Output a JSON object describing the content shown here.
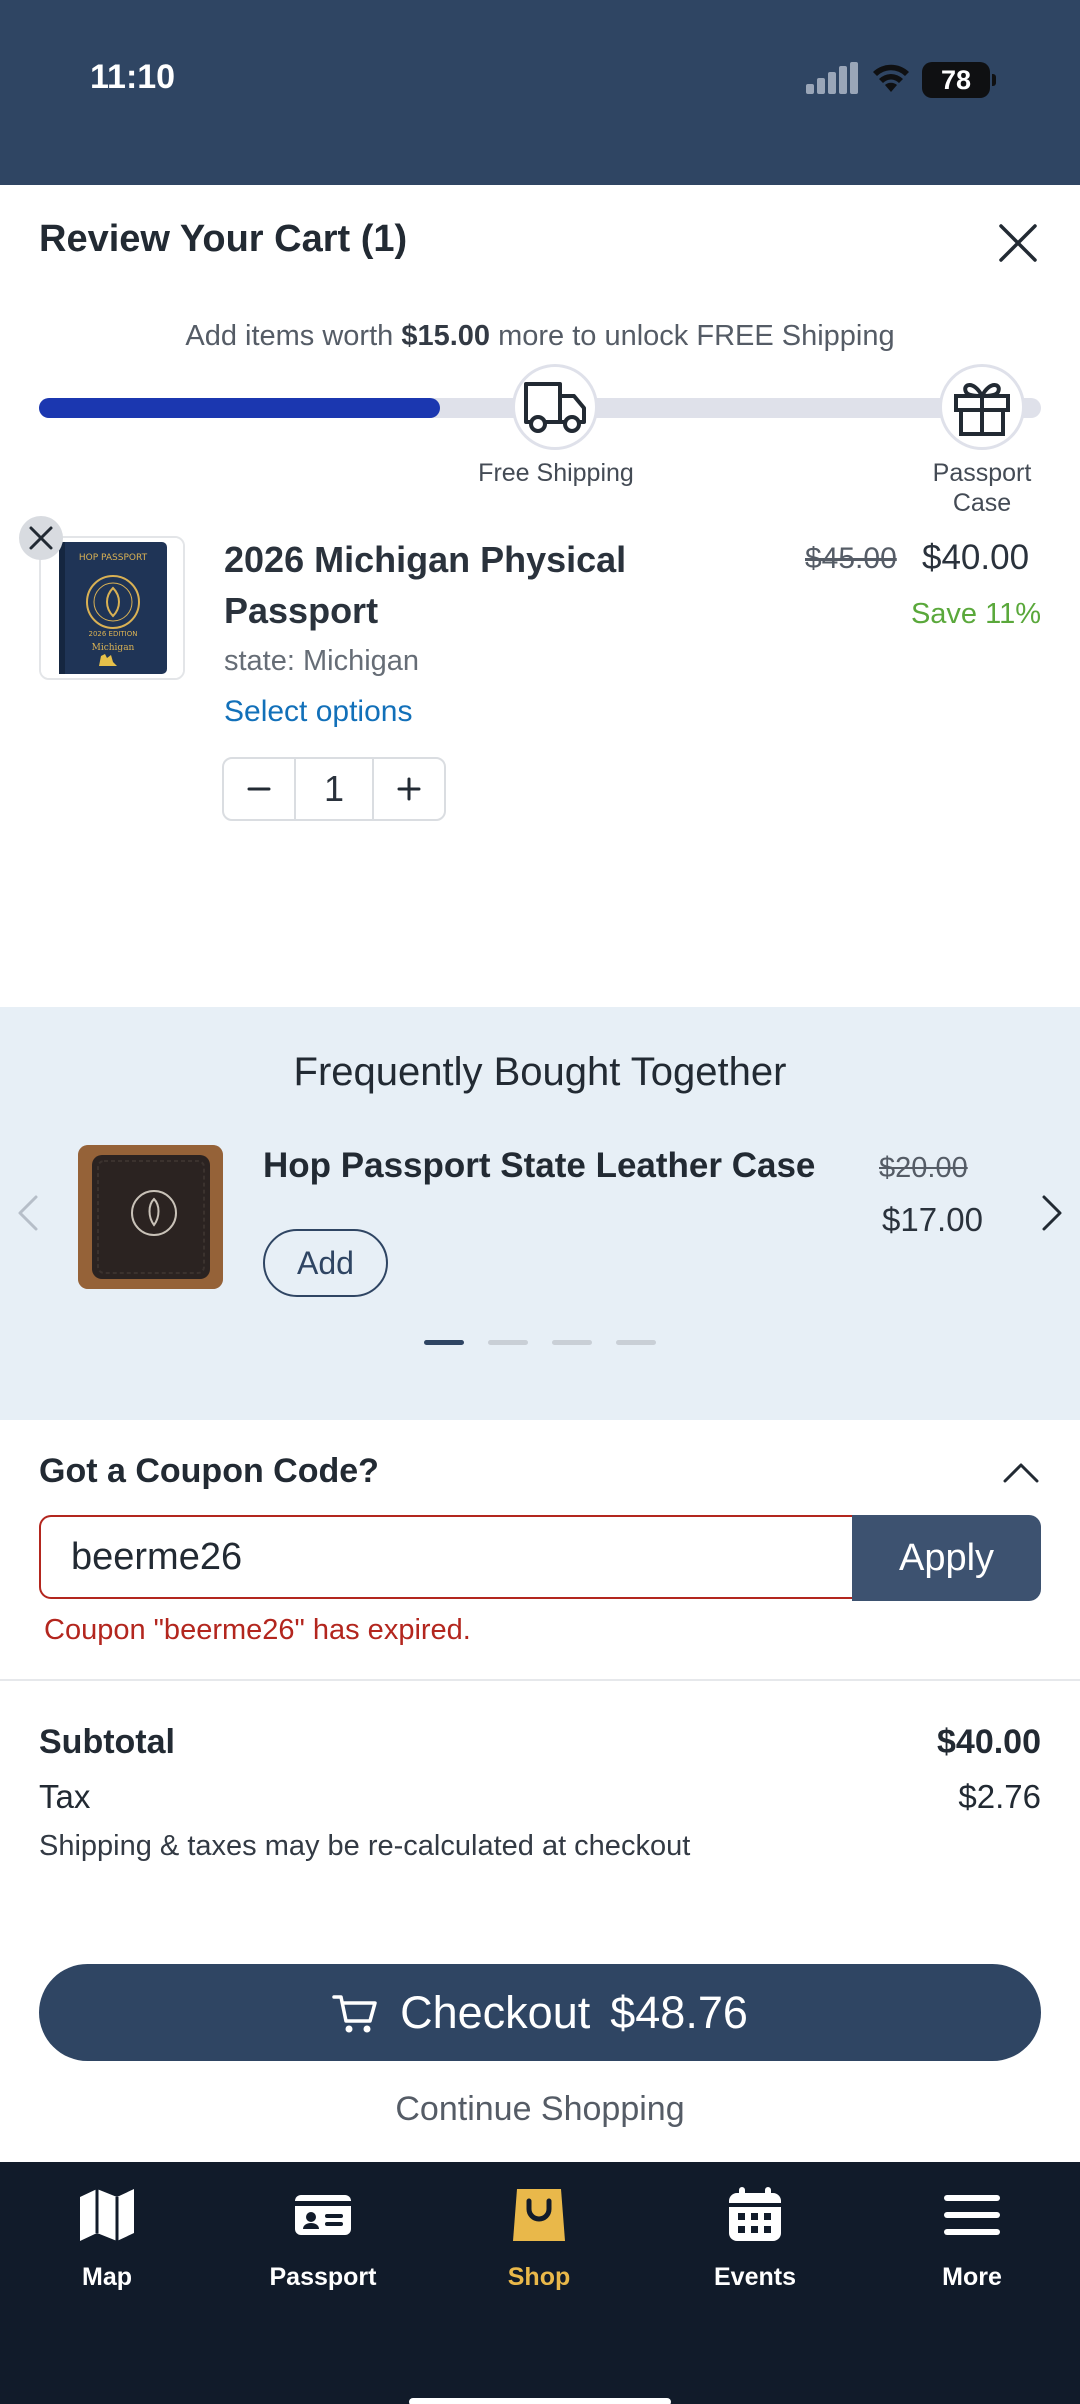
{
  "status_bar": {
    "time": "11:10",
    "battery": "78"
  },
  "cart": {
    "title": "Review Your Cart (1)",
    "shipping": {
      "message_prefix": "Add items worth ",
      "amount": "$15.00",
      "message_suffix": " more to unlock FREE Shipping",
      "progress_fraction": 0.4,
      "milestones": [
        {
          "label": "Free Shipping",
          "icon": "truck-icon"
        },
        {
          "label": "Passport Case",
          "icon": "gift-icon"
        }
      ]
    },
    "item": {
      "name": "2026 Michigan Physical Passport",
      "original_price": "$45.00",
      "price": "$40.00",
      "savings": "Save 11%",
      "variant": "state: Michigan",
      "select_options": "Select options",
      "quantity": "1",
      "thumbnail_text": {
        "brand": "HOP PASSPORT",
        "edition": "2026 EDITION",
        "state": "Michigan"
      }
    }
  },
  "upsell": {
    "title": "Frequently Bought Together",
    "product": {
      "name": "Hop Passport State Leather Case",
      "original_price": "$20.00",
      "price": "$17.00",
      "add_label": "Add"
    },
    "page_count": 4,
    "active_page": 1
  },
  "coupon": {
    "title": "Got a Coupon Code?",
    "value": "beerme26",
    "apply_label": "Apply",
    "error": "Coupon \"beerme26\" has expired."
  },
  "totals": {
    "subtotal_label": "Subtotal",
    "subtotal_value": "$40.00",
    "tax_label": "Tax",
    "tax_value": "$2.76",
    "note": "Shipping & taxes may be re-calculated at checkout"
  },
  "checkout": {
    "label": "Checkout",
    "amount": "$48.76",
    "continue_label": "Continue Shopping"
  },
  "tabbar": {
    "items": [
      {
        "label": "Map",
        "icon": "map-icon",
        "active": false
      },
      {
        "label": "Passport",
        "icon": "passport-icon",
        "active": false
      },
      {
        "label": "Shop",
        "icon": "shopping-bag-icon",
        "active": true
      },
      {
        "label": "Events",
        "icon": "calendar-icon",
        "active": false
      },
      {
        "label": "More",
        "icon": "menu-icon",
        "active": false
      }
    ]
  },
  "colors": {
    "navy": "#2f4563",
    "progress": "#1b37b0",
    "error": "#b3261e",
    "savings": "#5aa83b",
    "link": "#1270b9",
    "tab_active": "#e9b84a"
  }
}
